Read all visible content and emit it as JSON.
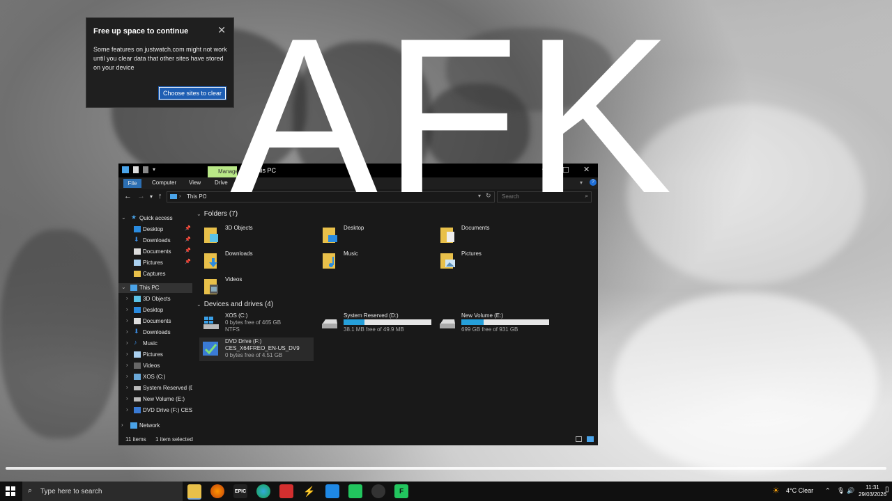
{
  "overlay": {
    "text": "AFK"
  },
  "notification": {
    "title": "Free up space to continue",
    "body": "Some features on justwatch.com might not work until you clear data that other sites have stored on your device",
    "button": "Choose sites to clear",
    "close": "✕"
  },
  "explorer": {
    "title": "This PC",
    "manage_tab": "Manage",
    "ribbon_tabs": {
      "file": "File",
      "computer": "Computer",
      "view": "View",
      "drive": "Drive"
    },
    "address": "This PC",
    "search_placeholder": "Search",
    "nav": {
      "quick_access": "Quick access",
      "qa_items": [
        "Desktop",
        "Downloads",
        "Documents",
        "Pictures",
        "Captures"
      ],
      "this_pc": "This PC",
      "pc_items": [
        "3D Objects",
        "Desktop",
        "Documents",
        "Downloads",
        "Music",
        "Pictures",
        "Videos",
        "XOS (C:)",
        "System Reserved (D:",
        "New Volume (E:)",
        "DVD Drive (F:) CES_"
      ],
      "network": "Network"
    },
    "folders_header": "Folders (7)",
    "folders": [
      "3D Objects",
      "Desktop",
      "Documents",
      "Downloads",
      "Music",
      "Pictures",
      "Videos"
    ],
    "drives_header": "Devices and drives (4)",
    "drives": [
      {
        "name": "XOS (C:)",
        "line2": "0 bytes free of 465 GB",
        "line3": "NTFS"
      },
      {
        "name": "System Reserved (D:)",
        "free": "38.1 MB free of 49.9 MB",
        "used_fraction": 0.24
      },
      {
        "name": "New Volume (E:)",
        "free": "699 GB free of 931 GB",
        "used_fraction": 0.25
      },
      {
        "name": "DVD Drive (F:)",
        "line2": "CES_X64FREO_EN-US_DV9",
        "line3": "0 bytes free of 4.51 GB"
      }
    ],
    "status": {
      "items": "11 items",
      "selected": "1 item selected"
    }
  },
  "taskbar": {
    "search_placeholder": "Type here to search",
    "weather": "4°C  Clear",
    "time": "11:31",
    "date": "29/03/2026",
    "apps": [
      "file-explorer",
      "firefox",
      "epic-games",
      "edge",
      "folder-red",
      "arrow-app",
      "blue-app",
      "teams-green",
      "steam",
      "green-app"
    ]
  },
  "colors": {
    "accent": "#2c6fb3",
    "manage": "#b9e887",
    "drive_bar": "#26a0da"
  }
}
